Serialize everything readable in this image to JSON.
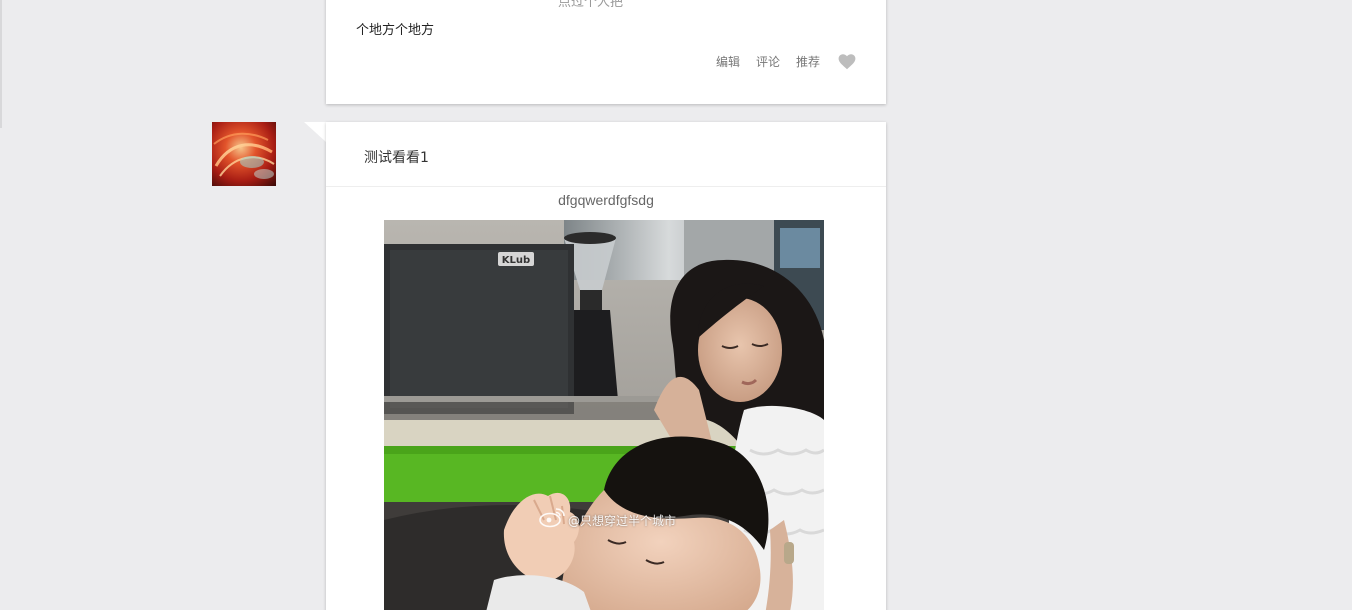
{
  "feed": {
    "post_1": {
      "cut_text": "点过个人把",
      "body": "个地方个地方",
      "actions": {
        "edit": "编辑",
        "comment": "评论",
        "recommend": "推荐"
      }
    },
    "post_2": {
      "title": "测试看看1",
      "subtitle": "dfgqwerdfgfsdg",
      "photo_brand_text": "KLub",
      "watermark": "@只想穿过半个城市"
    }
  },
  "colors": {
    "background": "#ececee",
    "card": "#ffffff",
    "action_text": "#777777",
    "heart": "#bdbdbd"
  }
}
